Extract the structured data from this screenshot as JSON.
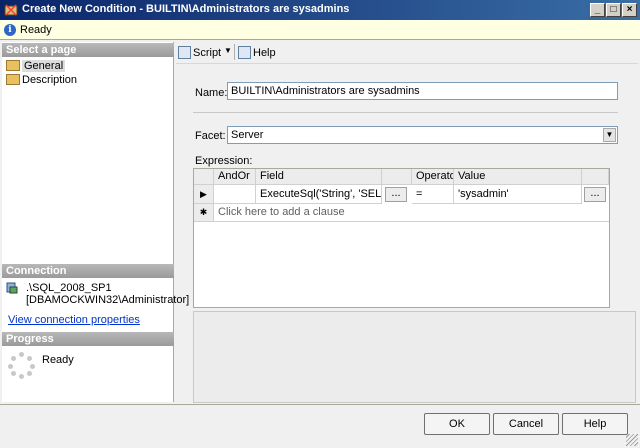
{
  "window": {
    "title": "Create New Condition - BUILTIN\\Administrators are sysadmins",
    "minimize": "_",
    "maximize": "□",
    "close": "×"
  },
  "status": {
    "text": "Ready",
    "icon": "info-icon"
  },
  "left": {
    "select_page_title": "Select a page",
    "pages": [
      {
        "label": "General",
        "icon": "page-icon"
      },
      {
        "label": "Description",
        "icon": "page-icon"
      }
    ],
    "connection_title": "Connection",
    "server": ".\\SQL_2008_SP1",
    "account": "[DBAMOCKWIN32\\Administrator]",
    "view_connection": "View connection properties",
    "progress_title": "Progress",
    "progress_status": "Ready"
  },
  "toolbar": {
    "script_label": "Script",
    "help_label": "Help"
  },
  "form": {
    "name_label": "Name:",
    "name_value": "BUILTIN\\Administrators are sysadmins",
    "facet_label": "Facet:",
    "facet_value": "Server",
    "expression_label": "Expression:"
  },
  "grid": {
    "columns": [
      "AndOr",
      "Field",
      "Operator",
      "Value"
    ],
    "rows": [
      {
        "andor": "",
        "field": "ExecuteSql('String', 'SELE...",
        "operator": "=",
        "value": "'sysadmin'"
      }
    ],
    "add_row_hint": "Click here to add a clause",
    "ellipsis": "...",
    "current_row_marker": "▶",
    "new_row_marker": "✱"
  },
  "buttons": {
    "ok": "OK",
    "cancel": "Cancel",
    "help": "Help"
  }
}
